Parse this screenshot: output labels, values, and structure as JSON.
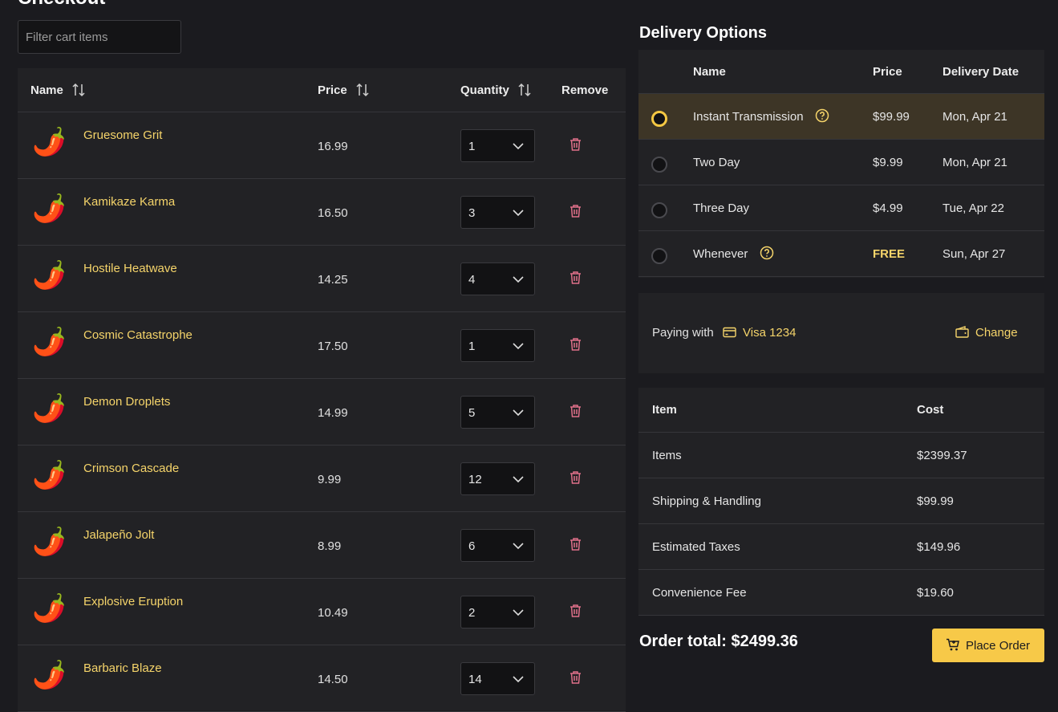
{
  "page": {
    "title": "Checkout"
  },
  "filter": {
    "placeholder": "Filter cart items"
  },
  "cart": {
    "headers": {
      "name": "Name",
      "price": "Price",
      "quantity": "Quantity",
      "remove": "Remove"
    },
    "items": [
      {
        "name": "Gruesome Grit",
        "price": "16.99",
        "qty": "1"
      },
      {
        "name": "Kamikaze Karma",
        "price": "16.50",
        "qty": "3"
      },
      {
        "name": "Hostile Heatwave",
        "price": "14.25",
        "qty": "4"
      },
      {
        "name": "Cosmic Catastrophe",
        "price": "17.50",
        "qty": "1"
      },
      {
        "name": "Demon Droplets",
        "price": "14.99",
        "qty": "5"
      },
      {
        "name": "Crimson Cascade",
        "price": "9.99",
        "qty": "12"
      },
      {
        "name": "Jalapeño Jolt",
        "price": "8.99",
        "qty": "6"
      },
      {
        "name": "Explosive Eruption",
        "price": "10.49",
        "qty": "2"
      },
      {
        "name": "Barbaric Blaze",
        "price": "14.50",
        "qty": "14"
      }
    ]
  },
  "delivery": {
    "title": "Delivery Options",
    "headers": {
      "name": "Name",
      "price": "Price",
      "date": "Delivery Date"
    },
    "options": [
      {
        "name": "Instant Transmission",
        "price": "$99.99",
        "date": "Mon, Apr 21",
        "selected": true,
        "help": true,
        "free": false
      },
      {
        "name": "Two Day",
        "price": "$9.99",
        "date": "Mon, Apr 21",
        "selected": false,
        "help": false,
        "free": false
      },
      {
        "name": "Three Day",
        "price": "$4.99",
        "date": "Tue, Apr 22",
        "selected": false,
        "help": false,
        "free": false
      },
      {
        "name": "Whenever",
        "price": "FREE",
        "date": "Sun, Apr 27",
        "selected": false,
        "help": true,
        "free": true
      }
    ]
  },
  "payment": {
    "label": "Paying with",
    "card": "Visa 1234",
    "change_label": "Change"
  },
  "summary": {
    "headers": {
      "item": "Item",
      "cost": "Cost"
    },
    "rows": [
      {
        "item": "Items",
        "cost": "$2399.37"
      },
      {
        "item": "Shipping & Handling",
        "cost": "$99.99"
      },
      {
        "item": "Estimated Taxes",
        "cost": "$149.96"
      },
      {
        "item": "Convenience Fee",
        "cost": "$19.60"
      }
    ]
  },
  "order": {
    "total": "Order total: $2499.36",
    "place_label": "Place Order"
  },
  "colors": {
    "accent": "#f7c948",
    "link": "#f5d46a",
    "trash": "#e0708a",
    "bg": "#1b1b1f",
    "panel": "#222225"
  }
}
